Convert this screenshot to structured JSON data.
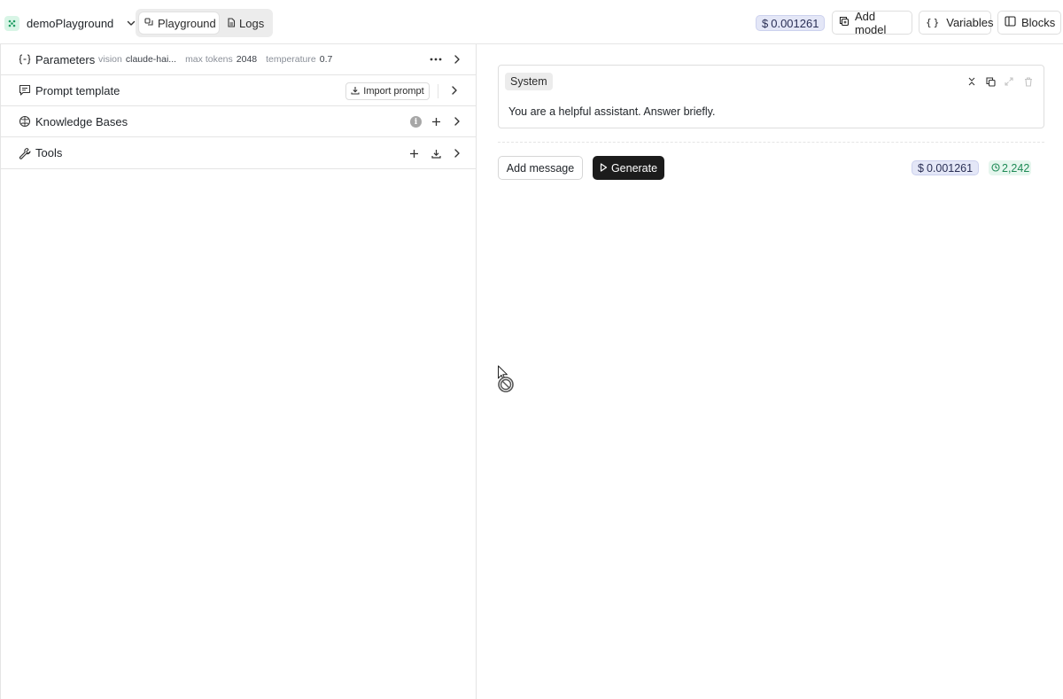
{
  "header": {
    "project_name": "demoPlayground",
    "tabs": [
      {
        "label": "Playground",
        "active": true
      },
      {
        "label": "Logs",
        "active": false
      }
    ],
    "cost": "0.001261",
    "currency_symbol": "$",
    "add_model_label": "Add model",
    "variables_label": "Variables",
    "blocks_label": "Blocks"
  },
  "left_panel": {
    "parameters": {
      "title": "Parameters",
      "meta": [
        {
          "key": "vision",
          "value": "claude-hai..."
        },
        {
          "key": "max tokens",
          "value": "2048"
        },
        {
          "key": "temperature",
          "value": "0.7"
        }
      ]
    },
    "prompt_template": {
      "title": "Prompt template",
      "import_label": "Import prompt"
    },
    "knowledge_bases": {
      "title": "Knowledge Bases",
      "info_glyph": "i"
    },
    "tools": {
      "title": "Tools"
    }
  },
  "main": {
    "system_label": "System",
    "system_message": "You are a helpful assistant. Answer briefly.",
    "add_message_label": "Add message",
    "generate_label": "Generate",
    "cost": "0.001261",
    "currency_symbol": "$",
    "tokens": "2,242"
  },
  "colors": {
    "accent_dark": "#1c1c1c",
    "cost_badge_bg": "#e4e7f7",
    "token_green": "#1e8a55",
    "logo_green": "#1f9d63"
  }
}
